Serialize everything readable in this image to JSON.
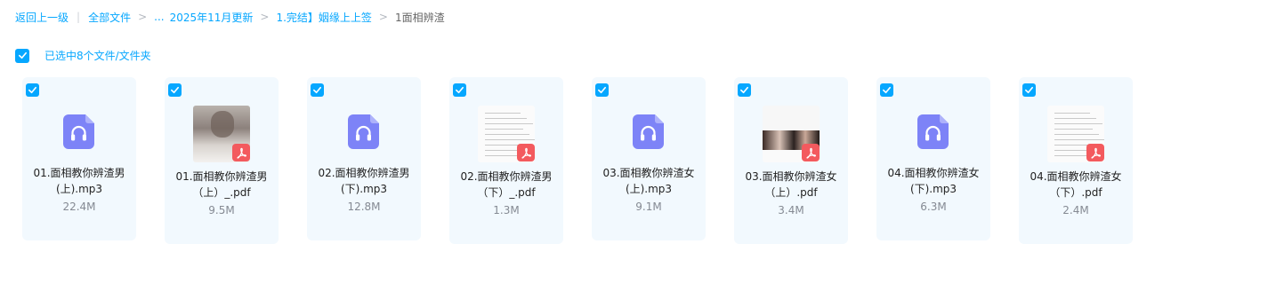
{
  "breadcrumb": {
    "back": "返回上一级",
    "all": "全部文件",
    "ellipsis": "...",
    "level1": "2025年11月更新",
    "level2": "1.完结】姻缘上上签",
    "current": "1面相辨渣"
  },
  "selection": {
    "text": "已选中8个文件/文件夹",
    "checked": true
  },
  "colors": {
    "accent": "#06a7ff",
    "card_bg": "#f2f9fe",
    "audio_icon": "#7d83f7",
    "pdf_badge": "#f35a5e"
  },
  "files": [
    {
      "type": "audio",
      "icon": "headphones-icon",
      "name": "01.面相教你辨渣男(上).mp3",
      "size": "22.4M",
      "checked": true
    },
    {
      "type": "pdf",
      "icon": "pdf-icon",
      "name": "01.面相教你辨渣男（上）_.pdf",
      "size": "9.5M",
      "checked": true
    },
    {
      "type": "audio",
      "icon": "headphones-icon",
      "name": "02.面相教你辨渣男(下).mp3",
      "size": "12.8M",
      "checked": true
    },
    {
      "type": "pdf",
      "icon": "pdf-icon",
      "name": "02.面相教你辨渣男（下）_.pdf",
      "size": "1.3M",
      "checked": true
    },
    {
      "type": "audio",
      "icon": "headphones-icon",
      "name": "03.面相教你辨渣女(上).mp3",
      "size": "9.1M",
      "checked": true
    },
    {
      "type": "pdf",
      "icon": "pdf-icon",
      "name": "03.面相教你辨渣女（上）.pdf",
      "size": "3.4M",
      "checked": true
    },
    {
      "type": "audio",
      "icon": "headphones-icon",
      "name": "04.面相教你辨渣女(下).mp3",
      "size": "6.3M",
      "checked": true
    },
    {
      "type": "pdf",
      "icon": "pdf-icon",
      "name": "04.面相教你辨渣女（下）.pdf",
      "size": "2.4M",
      "checked": true
    }
  ]
}
